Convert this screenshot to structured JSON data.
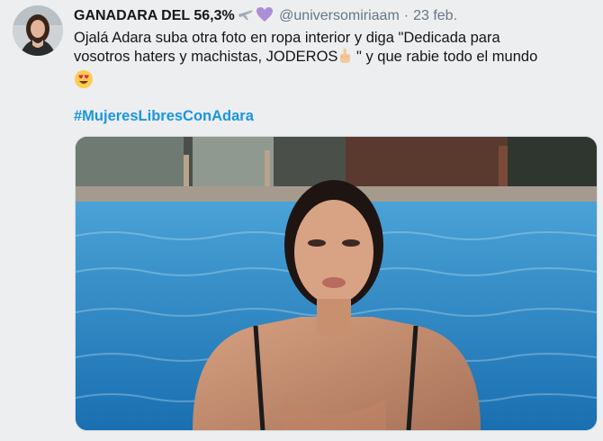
{
  "tweet": {
    "display_name": "GANADARA DEL 56,3%",
    "name_emojis": [
      "airplane-icon",
      "purple-heart-icon"
    ],
    "handle": "@universomiriaam",
    "separator": "·",
    "date": "23 feb.",
    "text_line1": "Ojalá Adara suba otra foto en ropa interior y diga \"Dedicada para",
    "text_line2a": "vosotros haters y machistas, JODEROS",
    "text_line2b": " \" y que rabie todo el mundo",
    "text_emojis": [
      "middle-finger-icon",
      "heart-eyes-icon"
    ],
    "hashtag": "#MujeresLibresConAdara",
    "media": {
      "description_icon": "photo-woman-in-pool"
    }
  },
  "colors": {
    "background": "#eceef0",
    "text": "#14171a",
    "muted": "#657786",
    "link": "#1b95e0",
    "pool": "#2a86c9"
  }
}
